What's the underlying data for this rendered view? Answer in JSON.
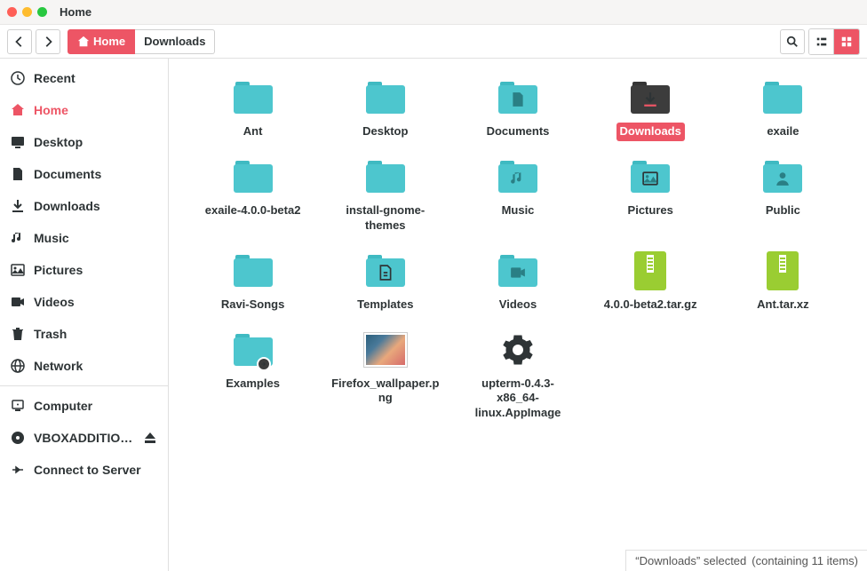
{
  "window": {
    "title": "Home",
    "dots": [
      "#ff5f57",
      "#febc2e",
      "#28c840"
    ]
  },
  "toolbar": {
    "breadcrumbs": [
      {
        "label": "Home",
        "active": true,
        "icon": "home"
      },
      {
        "label": "Downloads",
        "active": false
      }
    ]
  },
  "sidebar": {
    "groups": [
      [
        {
          "label": "Recent",
          "icon": "clock"
        },
        {
          "label": "Home",
          "icon": "home",
          "active": true
        },
        {
          "label": "Desktop",
          "icon": "desktop"
        },
        {
          "label": "Documents",
          "icon": "document"
        },
        {
          "label": "Downloads",
          "icon": "download"
        },
        {
          "label": "Music",
          "icon": "music"
        },
        {
          "label": "Pictures",
          "icon": "picture"
        },
        {
          "label": "Videos",
          "icon": "video"
        },
        {
          "label": "Trash",
          "icon": "trash"
        },
        {
          "label": "Network",
          "icon": "network"
        }
      ],
      [
        {
          "label": "Computer",
          "icon": "computer"
        },
        {
          "label": "VBOXADDITIO…",
          "icon": "disc",
          "eject": true
        },
        {
          "label": "Connect to Server",
          "icon": "connect"
        }
      ]
    ]
  },
  "files": [
    {
      "name": "Ant",
      "type": "folder"
    },
    {
      "name": "Desktop",
      "type": "folder"
    },
    {
      "name": "Documents",
      "type": "folder",
      "glyph": "document"
    },
    {
      "name": "Downloads",
      "type": "folder-dark",
      "glyph": "download",
      "selected": true
    },
    {
      "name": "exaile",
      "type": "folder"
    },
    {
      "name": "exaile-4.0.0-beta2",
      "type": "folder"
    },
    {
      "name": "install-gnome-themes",
      "type": "folder"
    },
    {
      "name": "Music",
      "type": "folder",
      "glyph": "music"
    },
    {
      "name": "Pictures",
      "type": "folder",
      "glyph": "picture"
    },
    {
      "name": "Public",
      "type": "folder",
      "glyph": "public"
    },
    {
      "name": "Ravi-Songs",
      "type": "folder"
    },
    {
      "name": "Templates",
      "type": "folder",
      "glyph": "template"
    },
    {
      "name": "Videos",
      "type": "folder",
      "glyph": "video"
    },
    {
      "name": "4.0.0-beta2.tar.gz",
      "type": "archive"
    },
    {
      "name": "Ant.tar.xz",
      "type": "archive"
    },
    {
      "name": "Examples",
      "type": "folder",
      "link": true
    },
    {
      "name": "Firefox_wallpaper.png",
      "type": "image"
    },
    {
      "name": "upterm-0.4.3-x86_64-linux.AppImage",
      "type": "appimage"
    }
  ],
  "status": {
    "selected": "“Downloads” selected",
    "info": "(containing 11 items)"
  }
}
